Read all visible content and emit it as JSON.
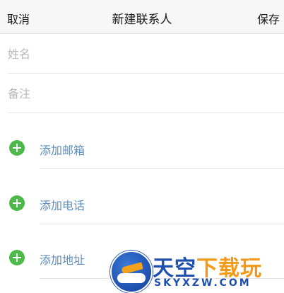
{
  "navbar": {
    "cancel_label": "取消",
    "title": "新建联系人",
    "save_label": "保存"
  },
  "form": {
    "name_placeholder": "姓名",
    "note_placeholder": "备注"
  },
  "add_rows": {
    "email_label": "添加邮箱",
    "phone_label": "添加电话",
    "address_label": "添加地址"
  },
  "colors": {
    "accent_green": "#4cb94a",
    "link_blue": "#5d8dbf"
  },
  "watermark": {
    "title_part1": "天空",
    "title_part2": "下载玩",
    "url": "SKYXZW.COM"
  }
}
